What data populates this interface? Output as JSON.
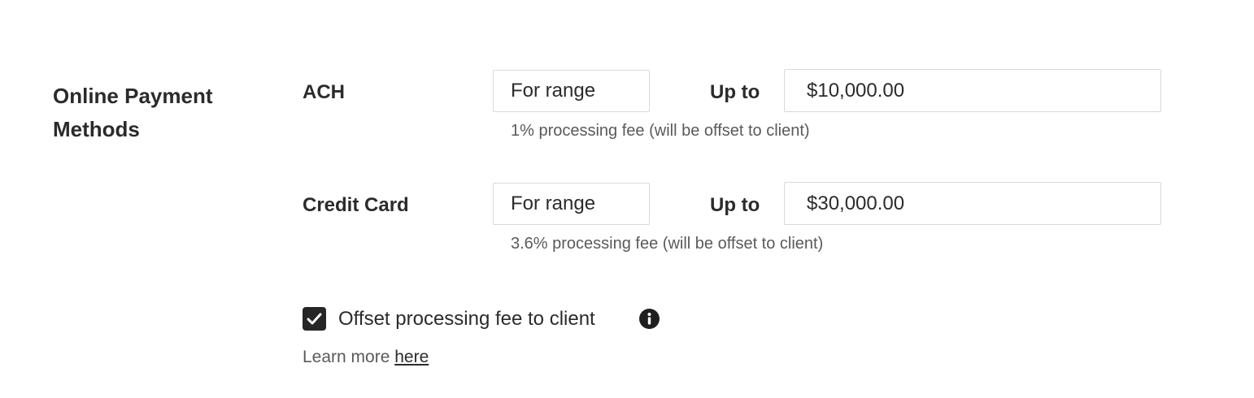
{
  "section": {
    "title_line1": "Online Payment",
    "title_line2": "Methods"
  },
  "methods": [
    {
      "label": "ACH",
      "range_select": "For range",
      "upto_label": "Up to",
      "amount": "$10,000.00",
      "fee_note": "1% processing fee (will be offset to client)"
    },
    {
      "label": "Credit Card",
      "range_select": "For range",
      "upto_label": "Up to",
      "amount": "$30,000.00",
      "fee_note": "3.6% processing fee (will be offset to client)"
    }
  ],
  "offset": {
    "checked": true,
    "label": "Offset processing fee to client",
    "info_icon": "info-icon"
  },
  "learn_more": {
    "prefix": "Learn more ",
    "link": "here"
  },
  "colors": {
    "text": "#2b2b2b",
    "muted": "#5a5a5a",
    "border": "#dcdad4",
    "checkbox": "#262626"
  }
}
